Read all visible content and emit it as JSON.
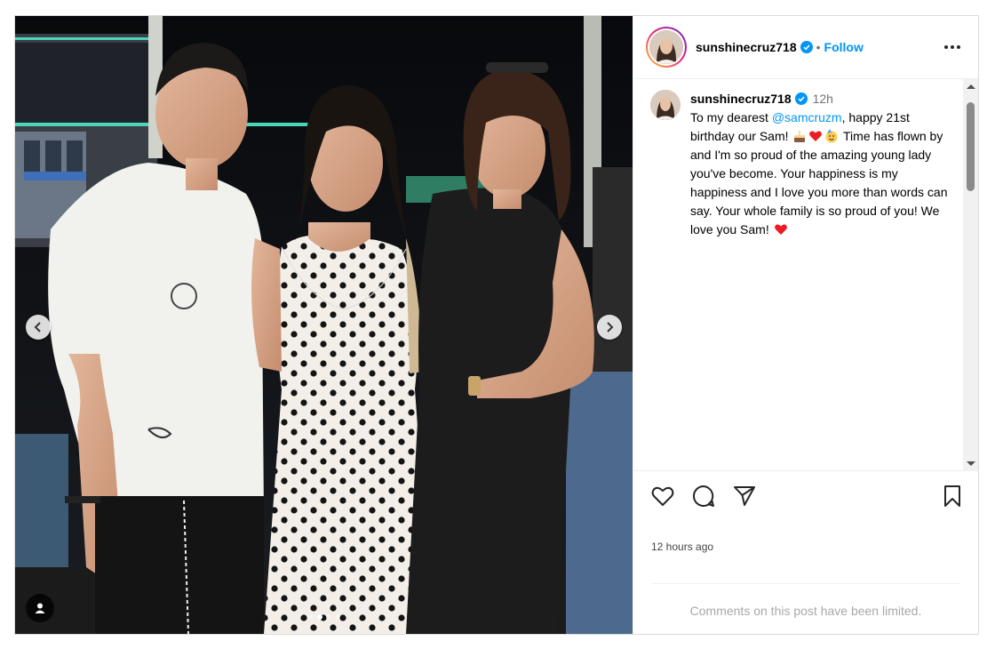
{
  "post": {
    "username": "sunshinecruz718",
    "follow_label": "Follow",
    "separator": "•",
    "verified": true,
    "caption": {
      "username": "sunshinecruz718",
      "time": "12h",
      "text_1": "To my dearest ",
      "mention": "@samcruzm",
      "text_2": ", happy 21st birthday our Sam! ",
      "text_3": " Time has flown by and I'm so proud of the amazing young lady you've become. Your happiness is my happiness and I love you more than words can say. Your whole family is so proud of you! We love you Sam! "
    },
    "timestamp": "12 hours ago",
    "comments_notice": "Comments on this post have been limited.",
    "carousel": {
      "slide_count": 4,
      "active_index": 1
    },
    "icons": {
      "like": "heart-icon",
      "comment": "comment-bubble-icon",
      "share": "paper-plane-icon",
      "save": "bookmark-icon",
      "more": "more-options-icon",
      "prev": "chevron-left-icon",
      "next": "chevron-right-icon",
      "tag": "user-tag-icon"
    },
    "colors": {
      "follow": "#0095f6",
      "verified": "#0095f6",
      "heart": "#ed1c24",
      "muted": "#737373"
    }
  }
}
